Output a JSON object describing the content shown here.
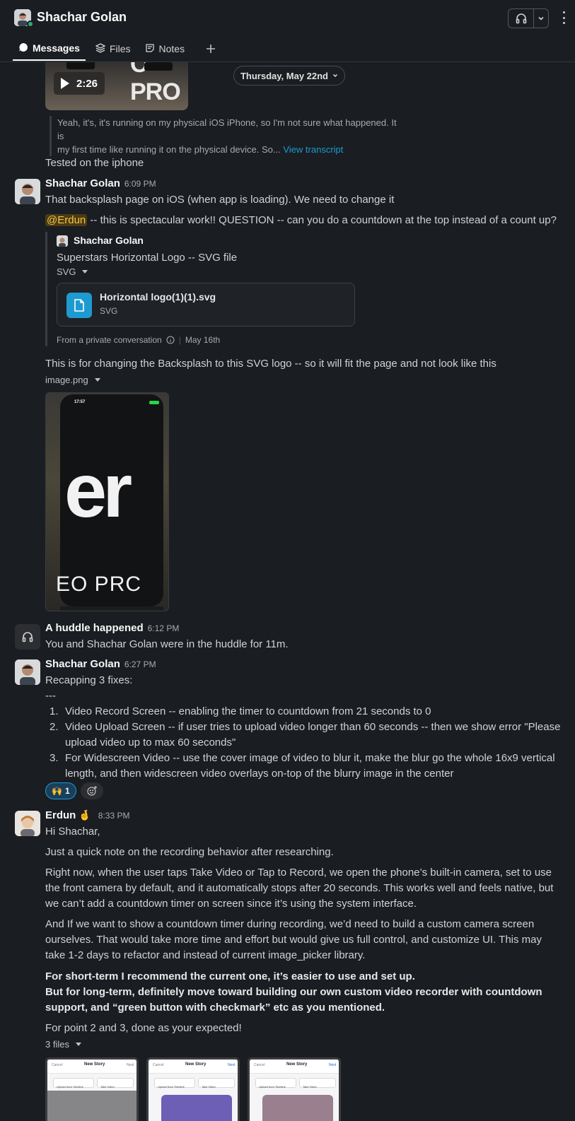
{
  "header": {
    "title": "Shachar Golan",
    "tabs": [
      {
        "label": "Messages",
        "icon": "message-icon"
      },
      {
        "label": "Files",
        "icon": "layers-icon"
      },
      {
        "label": "Notes",
        "icon": "note-icon"
      }
    ]
  },
  "top": {
    "video_duration": "2:26",
    "video_overlay_text": "O PRO",
    "date_divider": "Thursday, May 22nd",
    "transcript_line1": "Yeah, it's, it's running on my physical iOS iPhone, so I'm not sure what happened. It is",
    "transcript_line2": "my first time like running it on the physical device. So...",
    "view_transcript": "View transcript",
    "tested": "Tested on the iphone"
  },
  "msg1": {
    "author": "Shachar Golan",
    "time": "6:09 PM",
    "line1": "That backsplash page on iOS (when app is loading). We need to change it",
    "mention": "@Erdun",
    "line2": " -- this is spectacular work!! QUESTION -- can you do a countdown at the top instead of a count up?",
    "shared": {
      "author": "Shachar Golan",
      "title": "Superstars Horizontal Logo -- SVG file",
      "type_label": "SVG",
      "file_name": "Horizontal logo(1)(1).svg",
      "file_type": "SVG",
      "from": "From a private conversation",
      "date": "May 16th"
    },
    "line3": "This is for changing the Backsplash to this SVG logo -- so it will fit the page and not look like this",
    "image_name": "image.png",
    "image_time": "17:57",
    "image_text_big": "er",
    "image_text_bottom": "EO PRC"
  },
  "huddle": {
    "title": "A huddle happened",
    "time": "6:12 PM",
    "text": "You and Shachar Golan were in the huddle for 11m."
  },
  "msg2": {
    "author": "Shachar Golan",
    "time": "6:27 PM",
    "line1": "Recapping 3 fixes:",
    "line2": "---",
    "items": [
      {
        "n": "1.",
        "text": "Video Record Screen -- enabling the timer to countdown from 21 seconds to 0"
      },
      {
        "n": "2.",
        "text": "Video Upload Screen -- if user tries to upload video longer than 60 seconds -- then we show error \"Please upload video up to max 60 seconds\""
      },
      {
        "n": "3.",
        "text": "For Widescreen Video -- use the cover image of video to blur it, make the blur go the whole 16x9 vertical length, and then widescreen video overlays on-top of the blurry image in the center"
      }
    ],
    "reaction_emoji": "🙌",
    "reaction_count": "1"
  },
  "msg3": {
    "author": "Erdun",
    "author_emoji": "🤞",
    "time": "8:33 PM",
    "p1": "Hi Shachar,",
    "p2": "Just a quick note on the recording behavior after researching.",
    "p3": "Right now, when the user taps Take Video or Tap to Record, we open the phone’s built-in camera, set to use the front camera by default, and it automatically stops after 20 seconds. This works well and feels native, but we can’t add a countdown timer on screen since it’s using the system interface.",
    "p4": "And If we want to show a countdown timer during recording, we’d need to build a custom camera screen ourselves. That would take more time and effort but would give us full control, and customize UI. This may take 1-2 days to refactor and instead of current image_picker library.",
    "bold1": "For short-term I recommend the current one, it’s easier to use and set up.",
    "bold2": "But for long-term, definitely move toward building our own custom video recorder with countdown support, and “green button with checkmark” etc as you mentioned.",
    "p5": "For point 2 and 3, done as your expected!",
    "files_label": "3 files",
    "shots": [
      {
        "cancel": "Cancel",
        "title": "New Story",
        "next": "Next",
        "upload": "Upload from Timeline",
        "take": "Take Video"
      },
      {
        "cancel": "Cancel",
        "title": "New Story",
        "next": "Next",
        "upload": "Upload from Timeline",
        "take": "Take Video"
      },
      {
        "cancel": "Cancel",
        "title": "New Story",
        "next": "Next",
        "upload": "Upload from Timeline",
        "take": "Take Video"
      }
    ]
  }
}
